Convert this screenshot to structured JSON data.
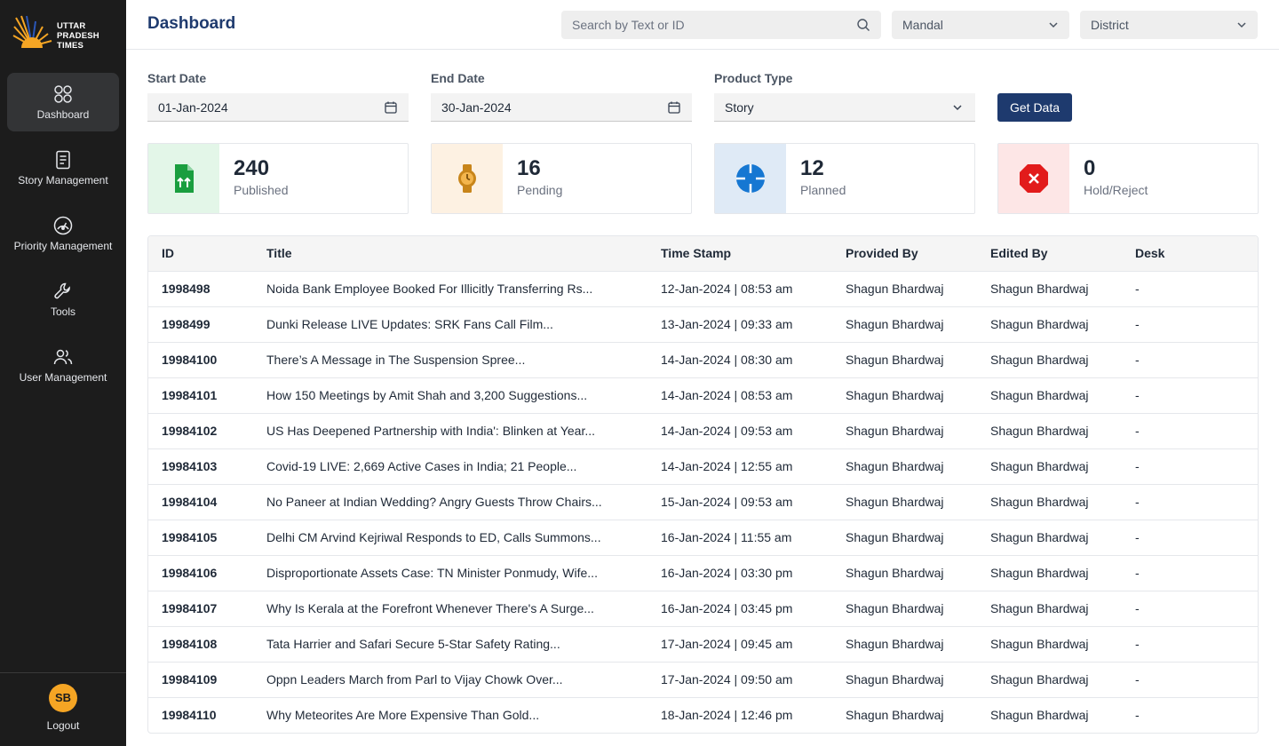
{
  "app": {
    "logo_lines": [
      "UTTAR",
      "PRADESH",
      "TIMES"
    ]
  },
  "sidebar": {
    "items": [
      {
        "label": "Dashboard",
        "icon": "grid-icon",
        "active": true
      },
      {
        "label": "Story Management",
        "icon": "document-icon"
      },
      {
        "label": "Priority Management",
        "icon": "gauge-icon"
      },
      {
        "label": "Tools",
        "icon": "wrench-icon"
      },
      {
        "label": "User Management",
        "icon": "users-icon"
      }
    ],
    "user_initials": "SB",
    "logout_label": "Logout"
  },
  "header": {
    "title": "Dashboard",
    "search_placeholder": "Search by Text or ID",
    "mandal_label": "Mandal",
    "district_label": "District"
  },
  "filters": {
    "start_date_label": "Start Date",
    "start_date_value": "01-Jan-2024",
    "end_date_label": "End Date",
    "end_date_value": "30-Jan-2024",
    "product_type_label": "Product Type",
    "product_type_value": "Story",
    "get_data_label": "Get Data"
  },
  "stats": [
    {
      "value": "240",
      "label": "Published",
      "icon": "file-upload-icon",
      "bg": "#e3f6e8",
      "color": "#1a9e3f"
    },
    {
      "value": "16",
      "label": "Pending",
      "icon": "watch-icon",
      "bg": "#fdf1e2",
      "color": "#c8851a"
    },
    {
      "value": "12",
      "label": "Planned",
      "icon": "target-icon",
      "bg": "#dfeaf6",
      "color": "#1677d2"
    },
    {
      "value": "0",
      "label": "Hold/Reject",
      "icon": "stop-icon",
      "bg": "#fde6e6",
      "color": "#e21b1b"
    }
  ],
  "table": {
    "columns": [
      "ID",
      "Title",
      "Time Stamp",
      "Provided By",
      "Edited By",
      "Desk"
    ],
    "rows": [
      [
        "1998498",
        "Noida Bank Employee Booked For Illicitly Transferring Rs...",
        "12-Jan-2024 | 08:53 am",
        "Shagun Bhardwaj",
        "Shagun Bhardwaj",
        "-"
      ],
      [
        "1998499",
        "Dunki Release LIVE Updates: SRK Fans Call Film...",
        "13-Jan-2024 | 09:33 am",
        "Shagun Bhardwaj",
        "Shagun Bhardwaj",
        "-"
      ],
      [
        "19984100",
        "There’s A Message in The Suspension Spree...",
        "14-Jan-2024 | 08:30 am",
        "Shagun Bhardwaj",
        "Shagun Bhardwaj",
        "-"
      ],
      [
        "19984101",
        "How 150 Meetings by Amit Shah and 3,200 Suggestions...",
        "14-Jan-2024 | 08:53 am",
        "Shagun Bhardwaj",
        "Shagun Bhardwaj",
        "-"
      ],
      [
        "19984102",
        "US Has Deepened Partnership with India': Blinken at Year...",
        "14-Jan-2024 | 09:53 am",
        "Shagun Bhardwaj",
        "Shagun Bhardwaj",
        "-"
      ],
      [
        "19984103",
        "Covid-19 LIVE: 2,669 Active Cases in India; 21 People...",
        "14-Jan-2024 | 12:55 am",
        "Shagun Bhardwaj",
        "Shagun Bhardwaj",
        "-"
      ],
      [
        "19984104",
        "No Paneer at Indian Wedding? Angry Guests Throw Chairs...",
        "15-Jan-2024 | 09:53 am",
        "Shagun Bhardwaj",
        "Shagun Bhardwaj",
        "-"
      ],
      [
        "19984105",
        "Delhi CM Arvind Kejriwal Responds to ED, Calls Summons...",
        "16-Jan-2024 | 11:55 am",
        "Shagun Bhardwaj",
        "Shagun Bhardwaj",
        "-"
      ],
      [
        "19984106",
        "Disproportionate Assets Case: TN Minister Ponmudy, Wife...",
        "16-Jan-2024 | 03:30 pm",
        "Shagun Bhardwaj",
        "Shagun Bhardwaj",
        "-"
      ],
      [
        "19984107",
        "Why Is Kerala at the Forefront Whenever There's A Surge...",
        "16-Jan-2024 | 03:45 pm",
        "Shagun Bhardwaj",
        "Shagun Bhardwaj",
        "-"
      ],
      [
        "19984108",
        "Tata Harrier and Safari Secure 5-Star Safety Rating...",
        "17-Jan-2024 | 09:45 am",
        "Shagun Bhardwaj",
        "Shagun Bhardwaj",
        "-"
      ],
      [
        "19984109",
        "Oppn Leaders March from Parl to Vijay Chowk Over...",
        "17-Jan-2024 | 09:50 am",
        "Shagun Bhardwaj",
        "Shagun Bhardwaj",
        "-"
      ],
      [
        "19984110",
        "Why Meteorites Are More Expensive Than Gold...",
        "18-Jan-2024 | 12:46 pm",
        "Shagun Bhardwaj",
        "Shagun Bhardwaj",
        "-"
      ]
    ]
  }
}
